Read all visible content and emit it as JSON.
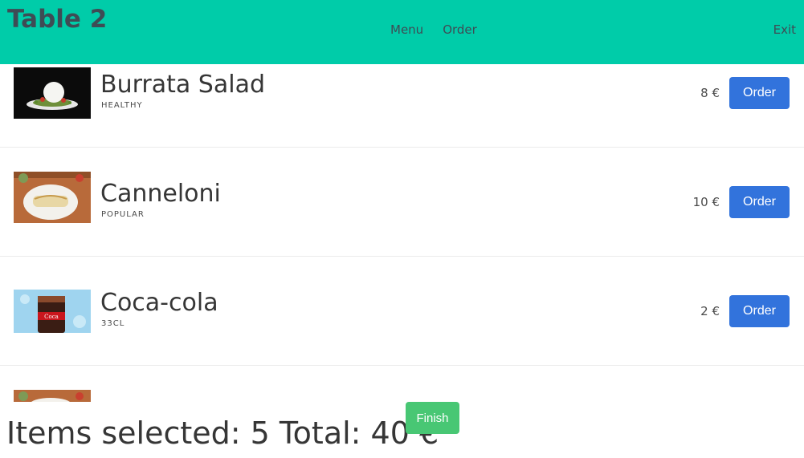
{
  "header": {
    "title": "Table 2",
    "nav": {
      "menu": "Menu",
      "order": "Order"
    },
    "exit": "Exit",
    "color": "#00cca9"
  },
  "items": [
    {
      "name": "Burrata Salad",
      "tag": "HEALTHY",
      "price": "8 €",
      "button": "Order",
      "image": "burrata-salad-image"
    },
    {
      "name": "Canneloni",
      "tag": "POPULAR",
      "price": "10 €",
      "button": "Order",
      "image": "canneloni-image"
    },
    {
      "name": "Coca-cola",
      "tag": "33CL",
      "price": "2 €",
      "button": "Order",
      "image": "coca-cola-image"
    },
    {
      "name": "",
      "tag": "",
      "price": "",
      "button": "",
      "image": "canneloni-image"
    }
  ],
  "footer": {
    "summary": "Items selected: 5 Total: 40 €",
    "finish": "Finish"
  },
  "colors": {
    "order_button": "#3273dc",
    "finish_button": "#48c774"
  }
}
